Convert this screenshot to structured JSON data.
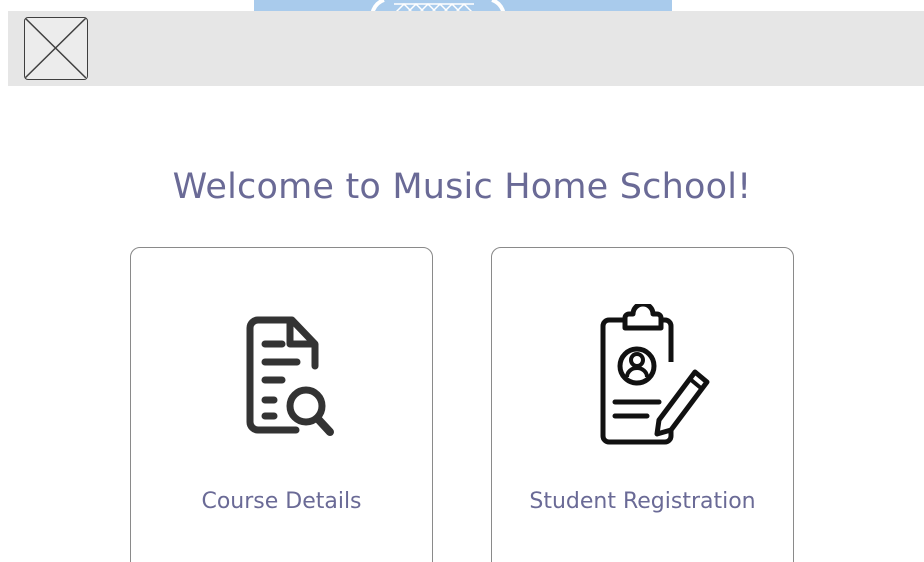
{
  "header": {
    "logo_icon": "image-placeholder-icon",
    "background": "#e6e6e6"
  },
  "main": {
    "title": "Welcome to Music Home School!",
    "title_color": "#6a6a96",
    "cards": [
      {
        "label": "Course Details",
        "icon": "document-search-icon"
      },
      {
        "label": "Student Registration",
        "icon": "clipboard-profile-edit-icon"
      }
    ]
  }
}
